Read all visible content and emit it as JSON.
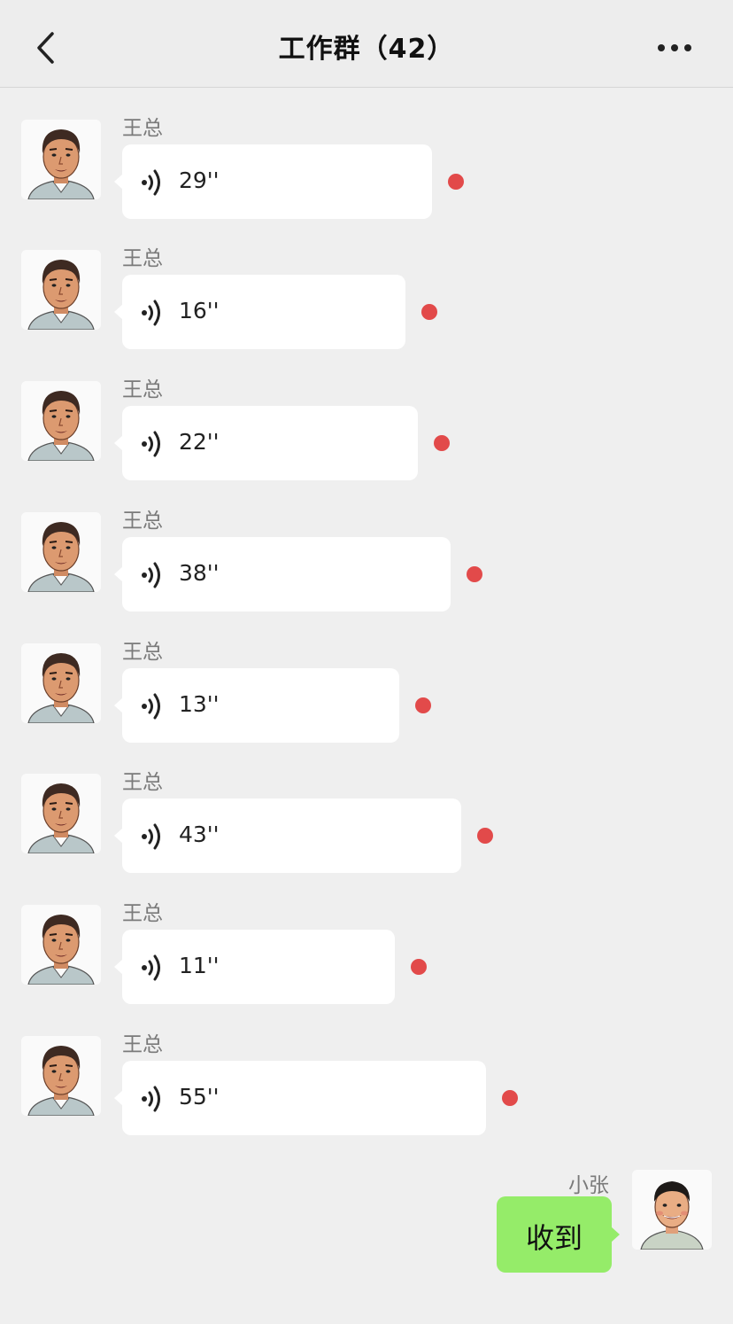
{
  "header": {
    "title": "工作群（42）",
    "back_icon": "chevron-left-icon",
    "more_icon": "more-dots-icon"
  },
  "messages": [
    {
      "sender": "王总",
      "duration": "29''",
      "unread": true
    },
    {
      "sender": "王总",
      "duration": "16''",
      "unread": true
    },
    {
      "sender": "王总",
      "duration": "22''",
      "unread": true
    },
    {
      "sender": "王总",
      "duration": "38''",
      "unread": true
    },
    {
      "sender": "王总",
      "duration": "13''",
      "unread": true
    },
    {
      "sender": "王总",
      "duration": "43''",
      "unread": true
    },
    {
      "sender": "王总",
      "duration": "11''",
      "unread": true
    },
    {
      "sender": "王总",
      "duration": "55''",
      "unread": true
    }
  ],
  "my_message": {
    "sender": "小张",
    "text": "收到"
  },
  "colors": {
    "background": "#efefef",
    "bubble_incoming": "#ffffff",
    "bubble_outgoing": "#95ec69",
    "unread_dot": "#e24a4a"
  }
}
